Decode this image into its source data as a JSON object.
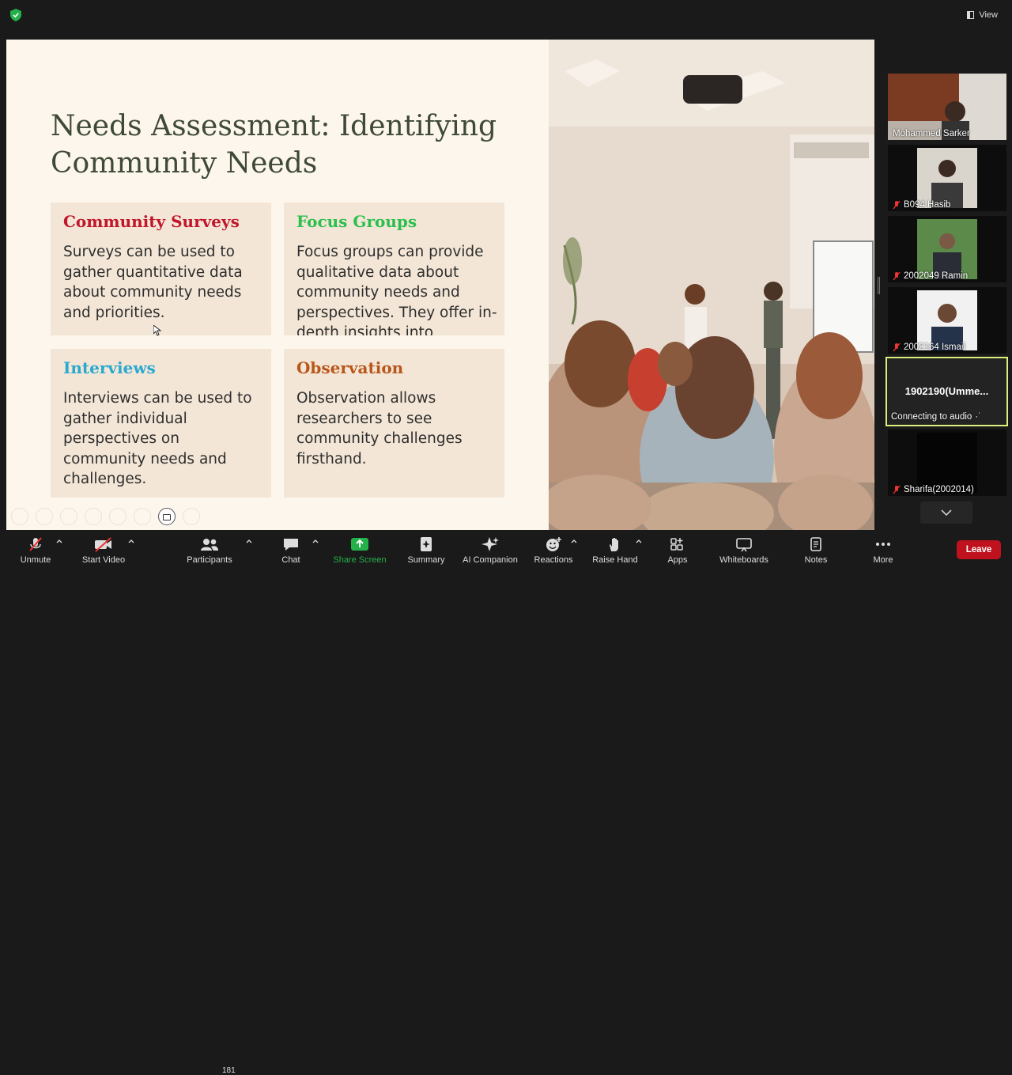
{
  "top": {
    "view_label": "View"
  },
  "slide": {
    "title": "Needs Assessment: Identifying Community Needs",
    "cards": [
      {
        "heading": "Community Surveys",
        "body": "Surveys can be used to gather quantitative data about community needs and priorities.",
        "color": "#c0172c"
      },
      {
        "heading": "Focus Groups",
        "body": "Focus groups can provide qualitative data about community needs and perspectives. They offer in-depth insights into",
        "color": "#2dbf4e"
      },
      {
        "heading": "Interviews",
        "body": "Interviews can be used to gather individual perspectives on community needs and challenges.",
        "color": "#2aa8cf"
      },
      {
        "heading": "Observation",
        "body": "Observation allows researchers to see community challenges firsthand.",
        "color": "#b9561a"
      }
    ]
  },
  "participants": [
    {
      "name": "Mohammed Sarker",
      "muted": false
    },
    {
      "name": "B094 Hasib",
      "muted": true
    },
    {
      "name": "2002049 Ramin",
      "muted": true
    },
    {
      "name": "2002164 Ismail",
      "muted": true
    },
    {
      "name": "1902190(Umme...",
      "status": "Connecting to audio",
      "speaking": true
    },
    {
      "name": "Sharifa(2002014)",
      "muted": true
    }
  ],
  "toolbar": {
    "unmute": "Unmute",
    "start_video": "Start Video",
    "participants": "Participants",
    "participant_count": "181",
    "chat": "Chat",
    "share_screen": "Share Screen",
    "summary": "Summary",
    "ai_companion": "AI Companion",
    "reactions": "Reactions",
    "raise_hand": "Raise Hand",
    "apps": "Apps",
    "whiteboards": "Whiteboards",
    "notes": "Notes",
    "more": "More",
    "leave": "Leave"
  },
  "colors": {
    "accent_green": "#24b149",
    "leave_red": "#c0121e",
    "active_speaker": "#d9f07a"
  }
}
